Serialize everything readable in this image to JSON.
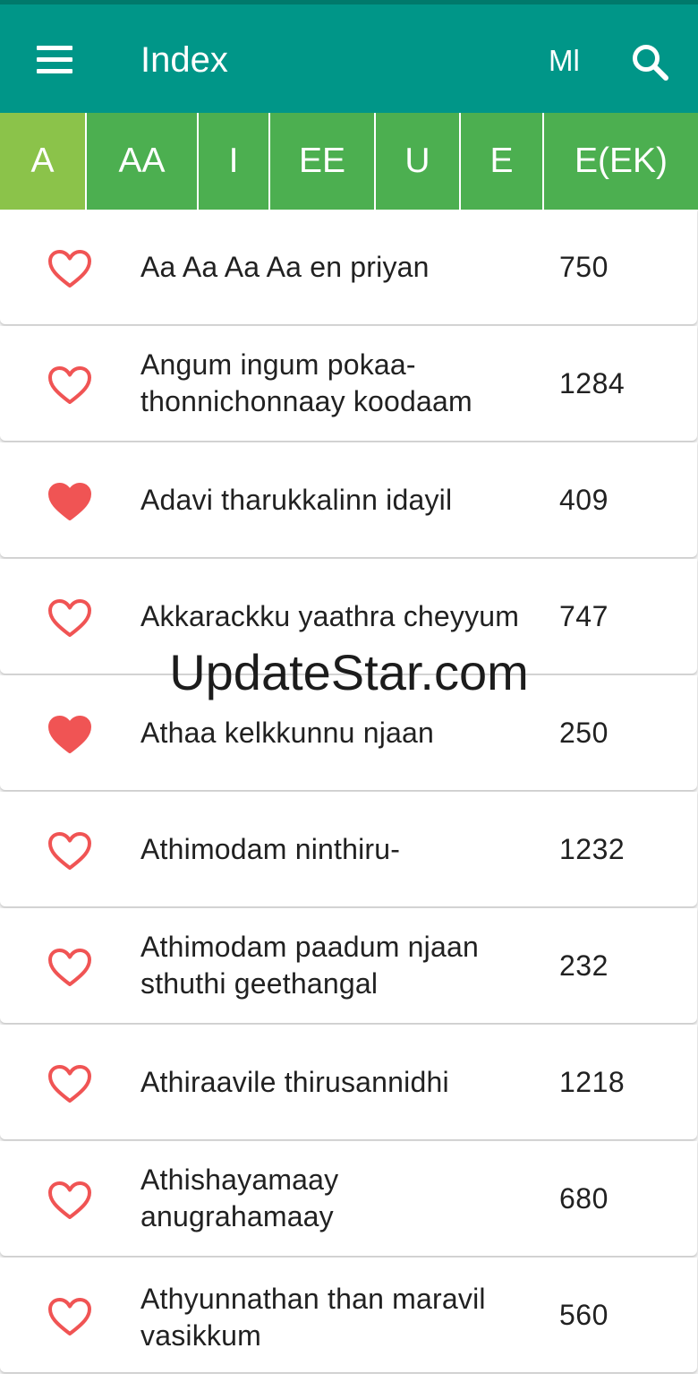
{
  "appbar": {
    "title": "Index",
    "language_label": "Ml",
    "menu_icon": "hamburger-menu-icon",
    "search_icon": "search-icon",
    "color": "#009688"
  },
  "tabs": [
    {
      "label": "A",
      "active": true
    },
    {
      "label": "AA",
      "active": false
    },
    {
      "label": "I",
      "active": false
    },
    {
      "label": "EE",
      "active": false
    },
    {
      "label": "U",
      "active": false
    },
    {
      "label": "E",
      "active": false
    },
    {
      "label": "E(EK)",
      "active": false
    }
  ],
  "tab_colors": {
    "normal": "#4caf50",
    "active": "#8bc34a"
  },
  "songs": [
    {
      "title": "Aa Aa Aa Aa en priyan",
      "number": "750",
      "favorite": false
    },
    {
      "title": "Angum ingum pokaa-\nthonnichonnaay koodaam",
      "number": "1284",
      "favorite": false
    },
    {
      "title": "Adavi tharukkalinn idayil",
      "number": "409",
      "favorite": true
    },
    {
      "title": "Akkarackku yaathra cheyyum",
      "number": "747",
      "favorite": false
    },
    {
      "title": "Athaa kelkkunnu njaan",
      "number": "250",
      "favorite": true
    },
    {
      "title": "Athimodam ninthiru-",
      "number": "1232",
      "favorite": false
    },
    {
      "title": "Athimodam paadum njaan\nsthuthi geethangal",
      "number": "232",
      "favorite": false
    },
    {
      "title": "Athiraavile thirusannidhi",
      "number": "1218",
      "favorite": false
    },
    {
      "title": "Athishayamaay\nanugrahamaay",
      "number": "680",
      "favorite": false
    },
    {
      "title": "Athyunnathan than maravil\nvasikkum",
      "number": "560",
      "favorite": false
    }
  ],
  "favorite_color": "#f05454",
  "watermark": "UpdateStar.com"
}
